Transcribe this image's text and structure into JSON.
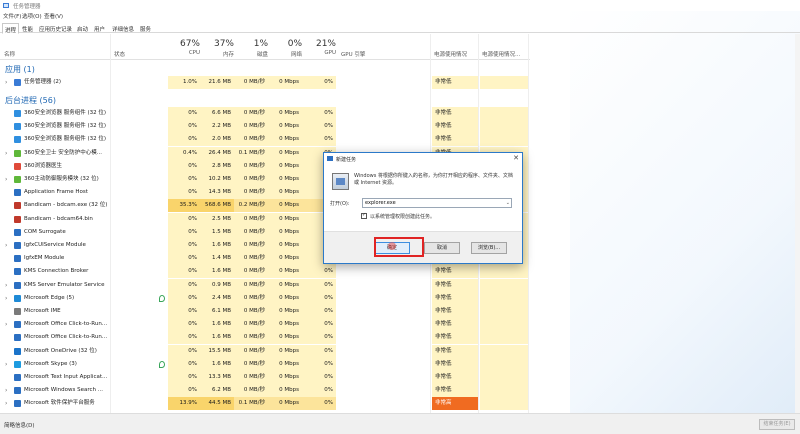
{
  "titlebar": {
    "title": "任务管理器"
  },
  "menus": [
    "文件(F)",
    "选项(O)",
    "查看(V)"
  ],
  "tabs": [
    "进程",
    "性能",
    "应用历史记录",
    "启动",
    "用户",
    "详细信息",
    "服务"
  ],
  "headers": {
    "name": "名称",
    "status": "状态",
    "cpu": {
      "pct": "67%",
      "label": "CPU"
    },
    "mem": {
      "pct": "37%",
      "label": "内存"
    },
    "disk": {
      "pct": "1%",
      "label": "磁盘"
    },
    "net": {
      "pct": "0%",
      "label": "网络"
    },
    "gpu": {
      "pct": "21%",
      "label": "GPU"
    },
    "gpu_engine": "GPU 引擎",
    "power": "电源使用情况",
    "power_trend": "电源使用情况..."
  },
  "sections": {
    "apps": "应用 (1)",
    "background": "后台进程 (56)"
  },
  "apps": [
    {
      "name": "任务管理器 (2)",
      "cpu": "1.0%",
      "mem": "21.6 MB",
      "disk": "0 MB/秒",
      "net": "0 Mbps",
      "gpu": "0%",
      "power": "非常低",
      "expand": true,
      "icon": "taskmgr-icon"
    }
  ],
  "processes": [
    {
      "name": "360安全浏览器 服务组件 (32 位)",
      "cpu": "0%",
      "mem": "6.6 MB",
      "disk": "0 MB/秒",
      "net": "0 Mbps",
      "gpu": "0%",
      "power": "非常低",
      "icon": "360-browser-icon"
    },
    {
      "name": "360安全浏览器 服务组件 (32 位)",
      "cpu": "0%",
      "mem": "2.2 MB",
      "disk": "0 MB/秒",
      "net": "0 Mbps",
      "gpu": "0%",
      "power": "非常低",
      "icon": "360-browser-icon"
    },
    {
      "name": "360安全浏览器 服务组件 (32 位)",
      "cpu": "0%",
      "mem": "2.0 MB",
      "disk": "0 MB/秒",
      "net": "0 Mbps",
      "gpu": "0%",
      "power": "非常低",
      "icon": "360-browser-icon"
    },
    {
      "name": "360安全卫士 安全防护中心模...",
      "cpu": "0.4%",
      "mem": "26.4 MB",
      "disk": "0.1 MB/秒",
      "net": "0 Mbps",
      "gpu": "0%",
      "power": "非常低",
      "icon": "360-safe-icon",
      "expand": true
    },
    {
      "name": "360浏览器医生",
      "cpu": "0%",
      "mem": "2.8 MB",
      "disk": "0 MB/秒",
      "net": "0 Mbps",
      "gpu": "0%",
      "power": "",
      "icon": "360-doctor-icon"
    },
    {
      "name": "360主动防御服务模块 (32 位)",
      "cpu": "0%",
      "mem": "10.2 MB",
      "disk": "0 MB/秒",
      "net": "0 Mbps",
      "gpu": "0%",
      "power": "",
      "icon": "360-defense-icon",
      "expand": true
    },
    {
      "name": "Application Frame Host",
      "cpu": "0%",
      "mem": "14.3 MB",
      "disk": "0 MB/秒",
      "net": "0 Mbps",
      "gpu": "0%",
      "power": "",
      "icon": "app-frame-icon"
    },
    {
      "name": "Bandicam - bdcam.exe (32 位)",
      "cpu": "35.3%",
      "mem": "568.6 MB",
      "disk": "0.2 MB/秒",
      "net": "0 Mbps",
      "gpu": "20",
      "power": "",
      "icon": "bandicam-icon",
      "hot": true
    },
    {
      "name": "Bandicam - bdcam64.bin",
      "cpu": "0%",
      "mem": "2.5 MB",
      "disk": "0 MB/秒",
      "net": "0 Mbps",
      "gpu": "0%",
      "power": "",
      "icon": "bandicam-icon"
    },
    {
      "name": "COM Surrogate",
      "cpu": "0%",
      "mem": "1.5 MB",
      "disk": "0 MB/秒",
      "net": "0 Mbps",
      "gpu": "0%",
      "power": "",
      "icon": "com-surrogate-icon"
    },
    {
      "name": "IgfxCUIService Module",
      "cpu": "0%",
      "mem": "1.6 MB",
      "disk": "0 MB/秒",
      "net": "0 Mbps",
      "gpu": "0%",
      "power": "",
      "icon": "service-icon",
      "expand": true
    },
    {
      "name": "IgfxEM Module",
      "cpu": "0%",
      "mem": "1.4 MB",
      "disk": "0 MB/秒",
      "net": "0 Mbps",
      "gpu": "0%",
      "power": "",
      "icon": "service-icon"
    },
    {
      "name": "KMS Connection Broker",
      "cpu": "0%",
      "mem": "1.6 MB",
      "disk": "0 MB/秒",
      "net": "0 Mbps",
      "gpu": "0%",
      "power": "非常低",
      "icon": "service-icon"
    },
    {
      "name": "KMS Server Emulator Service",
      "cpu": "0%",
      "mem": "0.9 MB",
      "disk": "0 MB/秒",
      "net": "0 Mbps",
      "gpu": "0%",
      "power": "非常低",
      "icon": "service-icon",
      "expand": true
    },
    {
      "name": "Microsoft Edge (5)",
      "cpu": "0%",
      "mem": "2.4 MB",
      "disk": "0 MB/秒",
      "net": "0 Mbps",
      "gpu": "0%",
      "power": "非常低",
      "icon": "edge-icon",
      "expand": true,
      "leaf": true
    },
    {
      "name": "Microsoft IME",
      "cpu": "0%",
      "mem": "6.1 MB",
      "disk": "0 MB/秒",
      "net": "0 Mbps",
      "gpu": "0%",
      "power": "非常低",
      "icon": "ime-icon"
    },
    {
      "name": "Microsoft Office Click-to-Run...",
      "cpu": "0%",
      "mem": "1.6 MB",
      "disk": "0 MB/秒",
      "net": "0 Mbps",
      "gpu": "0%",
      "power": "非常低",
      "icon": "office-icon",
      "expand": true
    },
    {
      "name": "Microsoft Office Click-to-Run...",
      "cpu": "0%",
      "mem": "1.6 MB",
      "disk": "0 MB/秒",
      "net": "0 Mbps",
      "gpu": "0%",
      "power": "非常低",
      "icon": "office-icon"
    },
    {
      "name": "Microsoft OneDrive (32 位)",
      "cpu": "0%",
      "mem": "15.5 MB",
      "disk": "0 MB/秒",
      "net": "0 Mbps",
      "gpu": "0%",
      "power": "非常低",
      "icon": "onedrive-icon"
    },
    {
      "name": "Microsoft Skype (3)",
      "cpu": "0%",
      "mem": "1.6 MB",
      "disk": "0 MB/秒",
      "net": "0 Mbps",
      "gpu": "0%",
      "power": "非常低",
      "icon": "skype-icon",
      "expand": true,
      "leaf": true
    },
    {
      "name": "Microsoft Text Input Applicat...",
      "cpu": "0%",
      "mem": "13.3 MB",
      "disk": "0 MB/秒",
      "net": "0 Mbps",
      "gpu": "0%",
      "power": "非常低",
      "icon": "service-icon"
    },
    {
      "name": "Microsoft Windows Search ...",
      "cpu": "0%",
      "mem": "6.2 MB",
      "disk": "0 MB/秒",
      "net": "0 Mbps",
      "gpu": "0%",
      "power": "非常低",
      "icon": "search-service-icon",
      "expand": true
    },
    {
      "name": "Microsoft 软件保护平台服务",
      "cpu": "13.9%",
      "mem": "44.5 MB",
      "disk": "0.1 MB/秒",
      "net": "0 Mbps",
      "gpu": "0%",
      "power": "非常高",
      "icon": "service-icon",
      "expand": true,
      "hot": true,
      "power_hi": true
    }
  ],
  "statusbar": {
    "fewer": "简略信息(D)",
    "end_task": "结束任务(E)"
  },
  "dialog": {
    "title": "新建任务",
    "desc": "Windows 将根据你所键入的名称，为你打开相应的程序、文件夹、文档或 Internet 资源。",
    "open_label": "打开(O):",
    "open_value": "explorer.exe",
    "admin_label": "以系统管理权限创建此任务。",
    "ok": "确定",
    "cancel": "取消",
    "browse": "浏览(B)..."
  },
  "colors": {
    "heat_light": "#fff4c4",
    "heat_mid": "#fce49b",
    "heat_hot": "#f9d46b",
    "power_high": "#f06b21",
    "section_blue": "#1f67b3",
    "accent_red": "#e02424"
  }
}
